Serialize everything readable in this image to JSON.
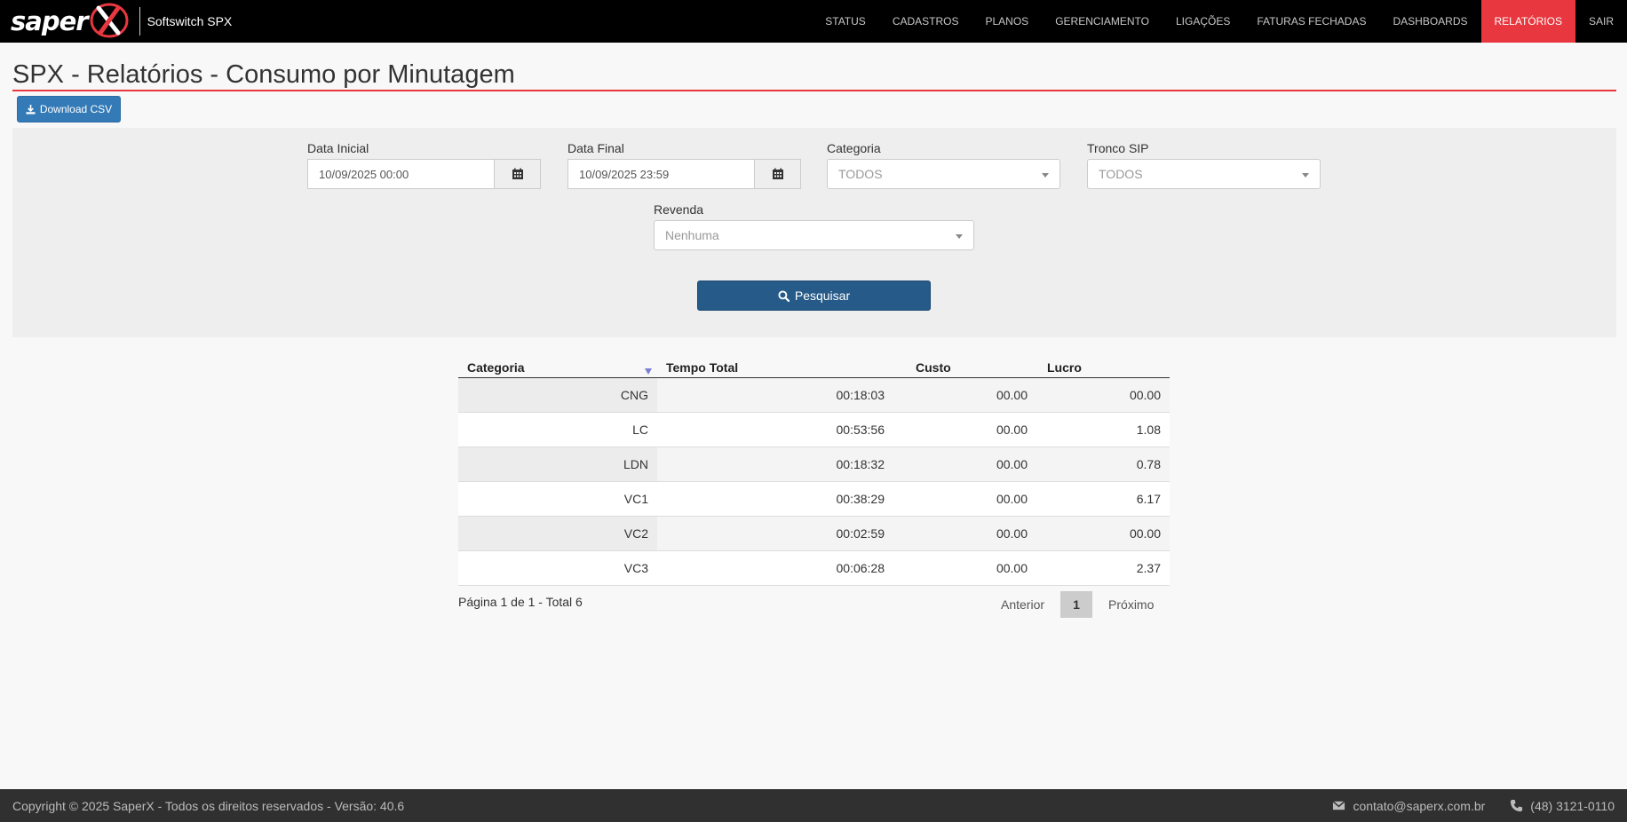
{
  "brand": {
    "logo_text": "saper",
    "product": "Softswitch SPX"
  },
  "nav": {
    "items": [
      "STATUS",
      "CADASTROS",
      "PLANOS",
      "GERENCIAMENTO",
      "LIGAÇÕES",
      "FATURAS FECHADAS",
      "DASHBOARDS",
      "RELATÓRIOS",
      "SAIR"
    ],
    "active": "RELATÓRIOS"
  },
  "page": {
    "title": "SPX - Relatórios - Consumo por Minutagem",
    "download_label": "Download CSV"
  },
  "filters": {
    "data_inicial": {
      "label": "Data Inicial",
      "value": "10/09/2025 00:00"
    },
    "data_final": {
      "label": "Data Final",
      "value": "10/09/2025 23:59"
    },
    "categoria": {
      "label": "Categoria",
      "value": "TODOS"
    },
    "tronco_sip": {
      "label": "Tronco SIP",
      "value": "TODOS"
    },
    "revenda": {
      "label": "Revenda",
      "value": "Nenhuma"
    },
    "search_label": "Pesquisar"
  },
  "table": {
    "columns": [
      "Categoria",
      "Tempo Total",
      "Custo",
      "Lucro"
    ],
    "rows": [
      [
        "CNG",
        "00:18:03",
        "00.00",
        "00.00"
      ],
      [
        "LC",
        "00:53:56",
        "00.00",
        "1.08"
      ],
      [
        "LDN",
        "00:18:32",
        "00.00",
        "0.78"
      ],
      [
        "VC1",
        "00:38:29",
        "00.00",
        "6.17"
      ],
      [
        "VC2",
        "00:02:59",
        "00.00",
        "00.00"
      ],
      [
        "VC3",
        "00:06:28",
        "00.00",
        "2.37"
      ]
    ]
  },
  "pagination": {
    "info": "Página 1 de 1 - Total 6",
    "prev": "Anterior",
    "current": "1",
    "next": "Próximo"
  },
  "footer": {
    "copyright": "Copyright © 2025 SaperX - Todos os direitos reservados - Versão: 40.6",
    "email": "contato@saperx.com.br",
    "phone": "(48) 3121-0110"
  },
  "colors": {
    "accent": "#e8373f",
    "primary": "#337ab7",
    "search": "#265a88"
  }
}
